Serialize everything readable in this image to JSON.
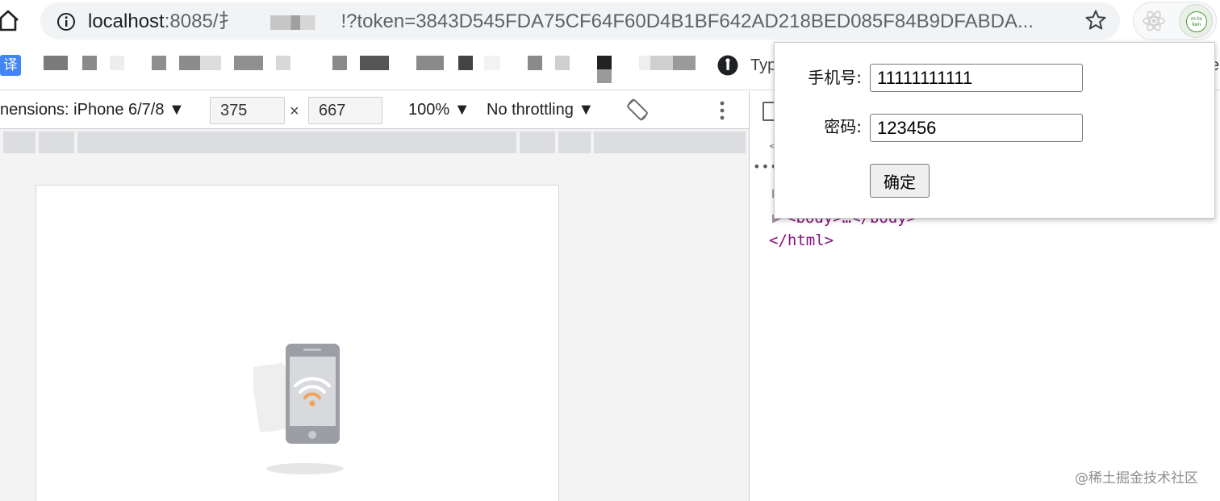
{
  "browser": {
    "url_host": "localhost",
    "url_port": ":8085/",
    "url_fragment": "扌",
    "url_query": "!?token=3843D545FDA75CF64F60D4B1BF642AD218BED085F84B9DFABDA...",
    "icons": [
      "home-icon",
      "info-icon",
      "star-icon",
      "react-icon"
    ],
    "avatar_text_line1": "m-to",
    "avatar_text_line2": "ken"
  },
  "bookmarks": {
    "translate_label": "译",
    "partial_label": "Typ",
    "edge_text": "e"
  },
  "device_toolbar": {
    "dimensions_label": "nensions: iPhone 6/7/8 ▼",
    "width_value": "375",
    "times": "×",
    "height_value": "667",
    "zoom_label": "100% ▼",
    "throttling_label": "No throttling ▼"
  },
  "elements": {
    "line_partial": "<",
    "body_line": "<body>…</body>",
    "html_close": "</html>"
  },
  "popup": {
    "phone_label": "手机号:",
    "phone_value": "11111111111",
    "password_label": "密码:",
    "password_value": "123456",
    "confirm_label": "确定"
  },
  "watermark": "@稀土掘金技术社区",
  "colors": {
    "accent_blue": "#4285f4",
    "tag_purple": "#881280",
    "wifi_orange": "#f0a35c",
    "avatar_green": "#4a9a3e"
  }
}
